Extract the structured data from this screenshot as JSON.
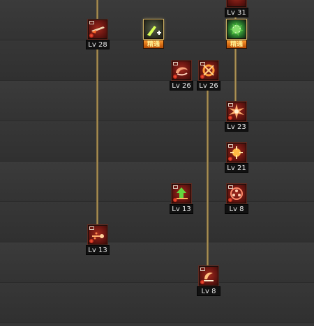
{
  "skills": {
    "lv31": {
      "level": "Lv 31",
      "icon": "upper-skill-icon",
      "type": "normal"
    },
    "lv28": {
      "level": "Lv 28",
      "icon": "blade-slash-icon",
      "type": "normal"
    },
    "elite_yellow": {
      "badge": "精通",
      "icon": "blaster-plus-icon",
      "type": "elite"
    },
    "elite_green": {
      "badge": "精通",
      "icon": "green-burst-icon",
      "type": "elite"
    },
    "lv26_left": {
      "level": "Lv 26",
      "icon": "whirl-icon",
      "type": "normal"
    },
    "lv26_right": {
      "level": "Lv 26",
      "icon": "fire-wheel-icon",
      "type": "normal"
    },
    "lv23": {
      "level": "Lv 23",
      "icon": "starburst-icon",
      "type": "normal"
    },
    "lv21": {
      "level": "Lv 21",
      "icon": "spark-orb-icon",
      "type": "normal"
    },
    "lv13_arrow": {
      "level": "Lv 13",
      "icon": "up-arrow-icon",
      "type": "normal"
    },
    "lv8_orb": {
      "level": "Lv 8",
      "icon": "ring-orb-icon",
      "type": "normal"
    },
    "lv13_left": {
      "level": "Lv 13",
      "icon": "spark-trail-icon",
      "type": "normal"
    },
    "lv8_bottom": {
      "level": "Lv 8",
      "icon": "hook-slash-icon",
      "type": "normal"
    }
  },
  "colors": {
    "background": "#363636",
    "line": "#b59a5a",
    "elite_badge": "#ff9a2d",
    "level_label_bg": "#111111"
  }
}
